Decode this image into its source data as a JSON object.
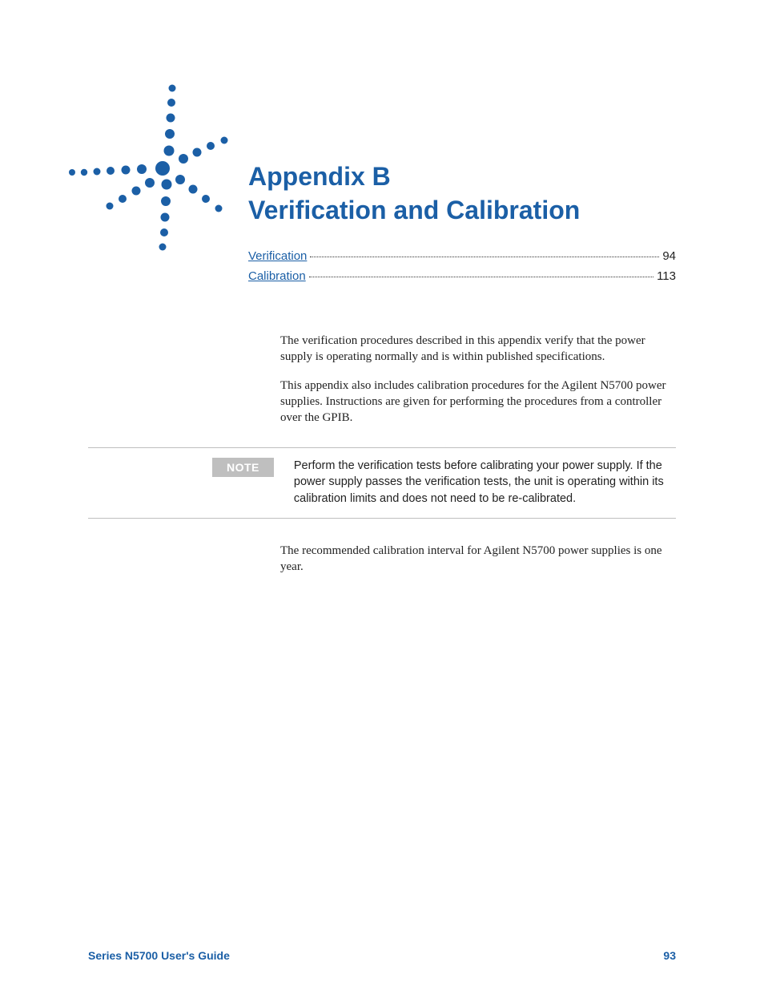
{
  "header": {
    "title_line1": "Appendix B",
    "title_line2": "Verification and Calibration"
  },
  "toc": {
    "items": [
      {
        "label": "Verification",
        "page": "94"
      },
      {
        "label": "Calibration",
        "page": "113"
      }
    ]
  },
  "paragraphs": {
    "p1": "The verification procedures described in this appendix verify that the power supply is operating normally and is within published specifications.",
    "p2": "This appendix also includes calibration procedures for the Agilent N5700 power supplies. Instructions are given for performing the procedures from a controller over the GPIB.",
    "p3": "The recommended calibration interval for Agilent N5700 power supplies is one year."
  },
  "note": {
    "label": "NOTE",
    "text": "Perform the verification tests before calibrating your power supply. If the power supply passes the verification tests, the unit is operating within its calibration limits and does not need to be re-calibrated."
  },
  "footer": {
    "left": "Series N5700 User's Guide",
    "right": "93"
  },
  "colors": {
    "brand_blue": "#1b5fa6",
    "note_gray": "#bfbfbf"
  }
}
